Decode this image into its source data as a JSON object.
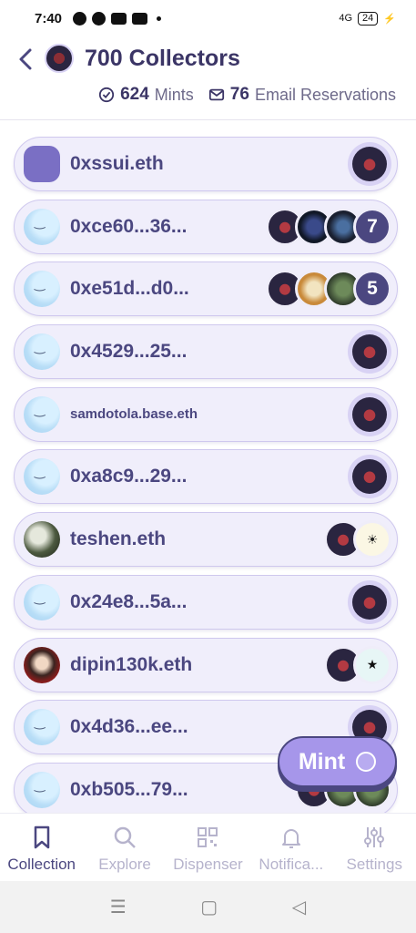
{
  "status_bar": {
    "time": "7:40",
    "network": "4G",
    "battery": "24"
  },
  "header": {
    "title": "700 Collectors",
    "mints_count": "624",
    "mints_label": "Mints",
    "email_count": "76",
    "email_label": "Email Reservations"
  },
  "collectors": [
    {
      "name": "0xssui.eth",
      "avatar": "hex",
      "badge": ""
    },
    {
      "name": "0xce60...36...",
      "avatar": "smile",
      "badge": "7"
    },
    {
      "name": "0xe51d...d0...",
      "avatar": "smile",
      "badge": "5"
    },
    {
      "name": "0x4529...25...",
      "avatar": "smile",
      "badge": ""
    },
    {
      "name": "samdotola.base.eth",
      "avatar": "smile",
      "badge": ""
    },
    {
      "name": "0xa8c9...29...",
      "avatar": "smile",
      "badge": ""
    },
    {
      "name": "teshen.eth",
      "avatar": "photo1",
      "badge": ""
    },
    {
      "name": "0x24e8...5a...",
      "avatar": "smile",
      "badge": ""
    },
    {
      "name": "dipin130k.eth",
      "avatar": "photo2",
      "badge": ""
    },
    {
      "name": "0x4d36...ee...",
      "avatar": "smile",
      "badge": ""
    },
    {
      "name": "0xb505...79...",
      "avatar": "smile",
      "badge": ""
    }
  ],
  "mint_button": {
    "label": "Mint"
  },
  "tabs": [
    {
      "label": "Collection",
      "icon": "bookmark-icon",
      "active": true
    },
    {
      "label": "Explore",
      "icon": "search-icon",
      "active": false
    },
    {
      "label": "Dispenser",
      "icon": "qr-icon",
      "active": false
    },
    {
      "label": "Notifica...",
      "icon": "bell-icon",
      "active": false
    },
    {
      "label": "Settings",
      "icon": "sliders-icon",
      "active": false
    }
  ],
  "colors": {
    "accent": "#4b4780",
    "accent_light": "#a696ea",
    "row_bg": "#f0eefb"
  }
}
